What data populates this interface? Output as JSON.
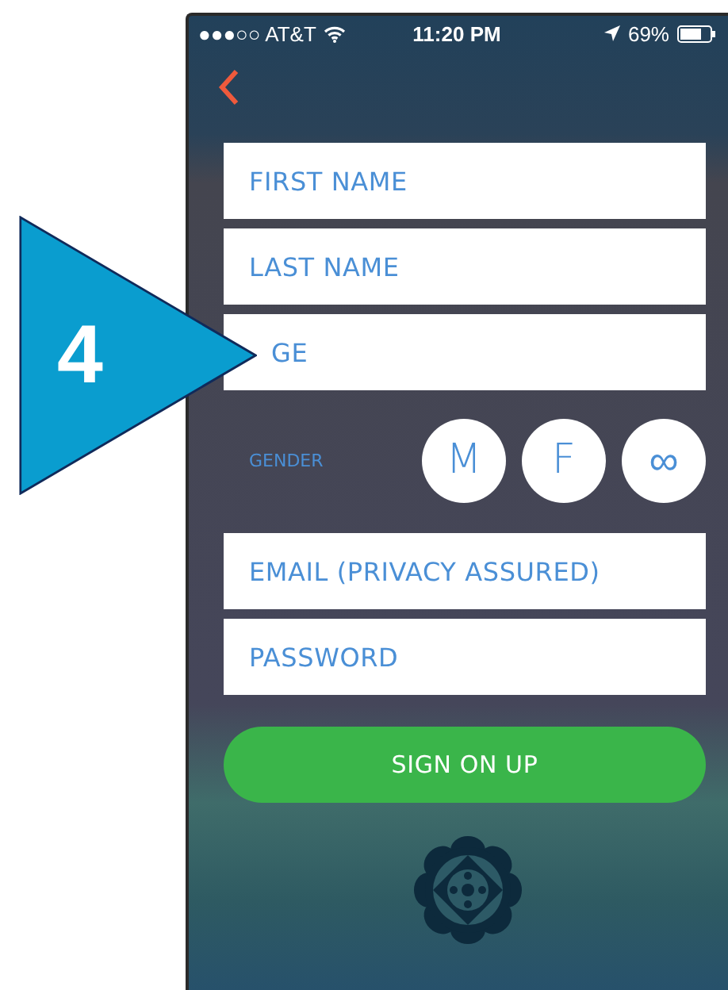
{
  "status_bar": {
    "carrier": "●●●○○ AT&T",
    "time": "11:20 PM",
    "battery": "69%"
  },
  "callout": {
    "number": "4"
  },
  "fields": [
    {
      "placeholder": "FIRST NAME"
    },
    {
      "placeholder": "LAST NAME"
    },
    {
      "placeholder": "GE"
    }
  ],
  "gender": {
    "label": "GENDER",
    "options": [
      {
        "label": "M",
        "selected": false
      },
      {
        "label": "F",
        "selected": false
      },
      {
        "label": "∞",
        "selected": false
      }
    ]
  },
  "account_fields": [
    {
      "placeholder": "EMAIL (PRIVACY ASSURED)"
    },
    {
      "placeholder": "PASSWORD"
    }
  ],
  "submit": {
    "label": "SIGN ON UP"
  }
}
